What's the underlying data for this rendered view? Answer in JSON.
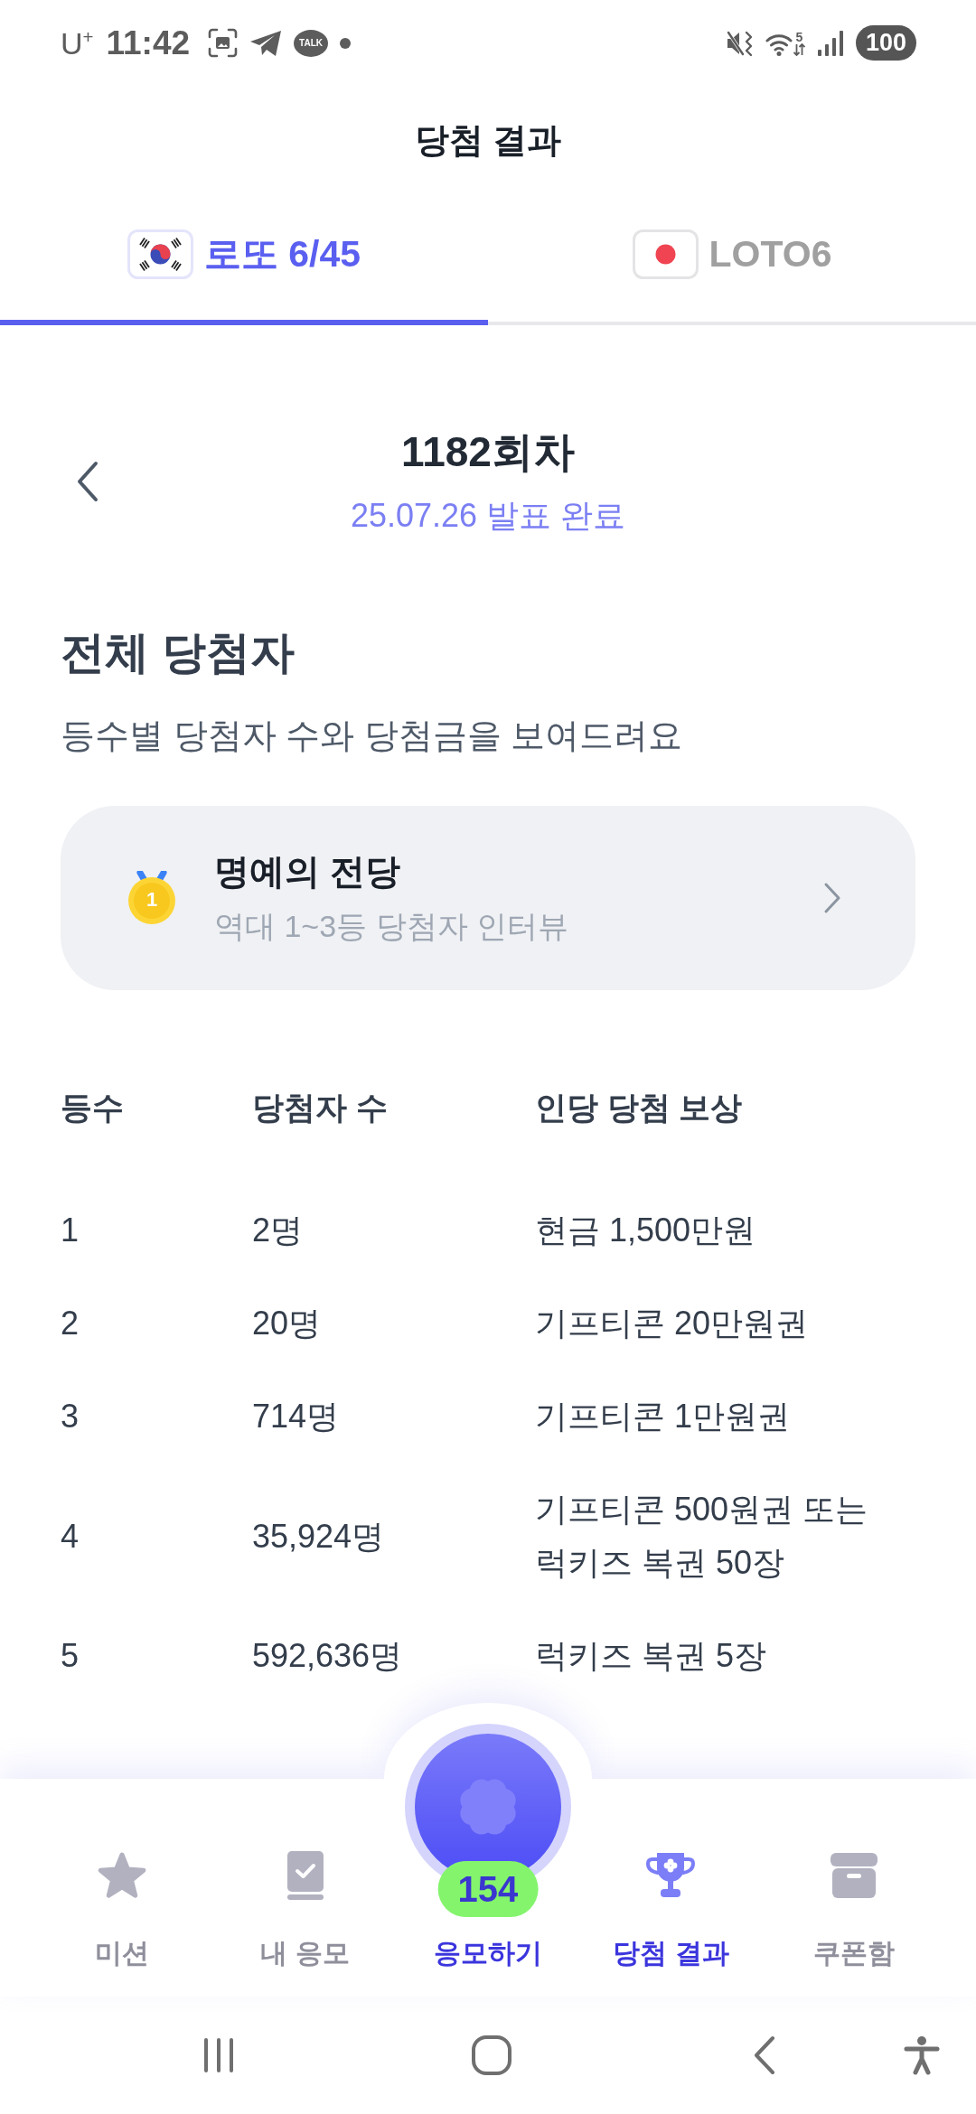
{
  "status_bar": {
    "carrier": "U$^{+}$",
    "time": "11:42",
    "chat_label": "TALK",
    "wifi_label": "5",
    "battery": "100"
  },
  "header": {
    "title": "당첨 결과"
  },
  "tabs": [
    {
      "kind": "korea",
      "label": "로또 6/45",
      "selected": true
    },
    {
      "kind": "japan",
      "label": "LOTO6",
      "selected": false
    }
  ],
  "round": {
    "title": "1182회차",
    "date": "25.07.26 발표 완료"
  },
  "summary": {
    "title": "전체 당첨자",
    "subtitle": "등수별 당첨자 수와 당첨금을 보여드려요"
  },
  "hall_of_fame": {
    "medal": "1",
    "title": "명예의 전당",
    "subtitle": "역대 1~3등 당첨자 인터뷰"
  },
  "table": {
    "columns": [
      "등수",
      "당첨자 수",
      "인당 당첨 보상"
    ],
    "rows": [
      [
        "1",
        "2명",
        "현금 1,500만원"
      ],
      [
        "2",
        "20명",
        "기프티콘 20만원권"
      ],
      [
        "3",
        "714명",
        "기프티콘 1만원권"
      ],
      [
        "4",
        "35,924명",
        "기프티콘 500원권 또는 럭키즈 복권 50장"
      ],
      [
        "5",
        "592,636명",
        "럭키즈 복권 5장"
      ]
    ]
  },
  "bottom_nav": {
    "items": [
      {
        "kind": "star",
        "label": "미션",
        "selected": false
      },
      {
        "kind": "book",
        "label": "내 응모",
        "selected": false
      },
      {
        "kind": "trophy",
        "label": "당첨 결과",
        "selected": true
      },
      {
        "kind": "box",
        "label": "쿠폰함",
        "selected": false
      }
    ],
    "entry_button": {
      "label": "응모하기",
      "badge": "154"
    }
  }
}
